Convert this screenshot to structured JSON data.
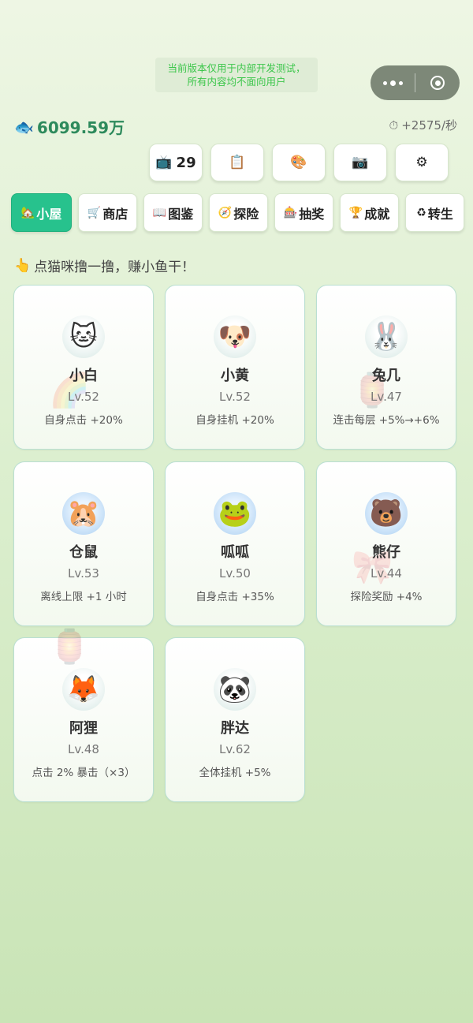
{
  "notice": {
    "line1": "当前版本仅用于内部开发测试，",
    "line2": "所有内容均不面向用户"
  },
  "capsule": {
    "menu_icon": "more-dots-icon",
    "close_icon": "target-circle-icon"
  },
  "stats": {
    "coins_icon": "fish-icon",
    "coins": "6099.59万",
    "rate_icon": "stopwatch-icon",
    "rate": "+2575/秒"
  },
  "toolbar": [
    {
      "icon": "📺",
      "icon_name": "tv-icon",
      "label": "29"
    },
    {
      "icon": "📋",
      "icon_name": "clipboard-icon",
      "label": ""
    },
    {
      "icon": "🎨",
      "icon_name": "palette-icon",
      "label": ""
    },
    {
      "icon": "📷",
      "icon_name": "camera-icon",
      "label": ""
    },
    {
      "icon": "⚙",
      "icon_name": "gear-icon",
      "label": ""
    }
  ],
  "nav": [
    {
      "icon": "🏡",
      "icon_name": "house-icon",
      "label": "小屋",
      "active": true
    },
    {
      "icon": "🛒",
      "icon_name": "cart-icon",
      "label": "商店"
    },
    {
      "icon": "📖",
      "icon_name": "book-icon",
      "label": "图鉴"
    },
    {
      "icon": "🧭",
      "icon_name": "compass-icon",
      "label": "探险"
    },
    {
      "icon": "🎰",
      "icon_name": "slot-machine-icon",
      "label": "抽奖"
    },
    {
      "icon": "🏆",
      "icon_name": "trophy-icon",
      "label": "成就"
    },
    {
      "icon": "♻",
      "icon_name": "recycle-icon",
      "label": "转生"
    }
  ],
  "hint": {
    "icon": "👆",
    "text": "点猫咪撸一撸，赚小鱼干！"
  },
  "pets": [
    {
      "emoji": "🐱",
      "icon_name": "cat-icon",
      "name": "小白",
      "level": "Lv.52",
      "skill": "自身点击 +20%",
      "decor": "🌈"
    },
    {
      "emoji": "🐶",
      "icon_name": "dog-icon",
      "name": "小黄",
      "level": "Lv.52",
      "skill": "自身挂机 +20%"
    },
    {
      "emoji": "🐰",
      "icon_name": "rabbit-icon",
      "name": "兔几",
      "level": "Lv.47",
      "skill": "连击每层 +5%→+6%",
      "decor": "🏮"
    },
    {
      "emoji": "🐹",
      "icon_name": "hamster-icon",
      "name": "仓鼠",
      "level": "Lv.53",
      "skill": "离线上限 +1 小时",
      "blue": true
    },
    {
      "emoji": "🐸",
      "icon_name": "frog-icon",
      "name": "呱呱",
      "level": "Lv.50",
      "skill": "自身点击 +35%",
      "blue": true
    },
    {
      "emoji": "🐻",
      "icon_name": "bear-icon",
      "name": "熊仔",
      "level": "Lv.44",
      "skill": "探险奖励 +4%",
      "blue": true,
      "decor": "🎀"
    },
    {
      "emoji": "🦊",
      "icon_name": "fox-icon",
      "name": "阿狸",
      "level": "Lv.48",
      "skill": "点击 2% 暴击（×3）",
      "decor": "🏮"
    },
    {
      "emoji": "🐼",
      "icon_name": "panda-icon",
      "name": "胖达",
      "level": "Lv.62",
      "skill": "全体挂机 +5%"
    }
  ]
}
